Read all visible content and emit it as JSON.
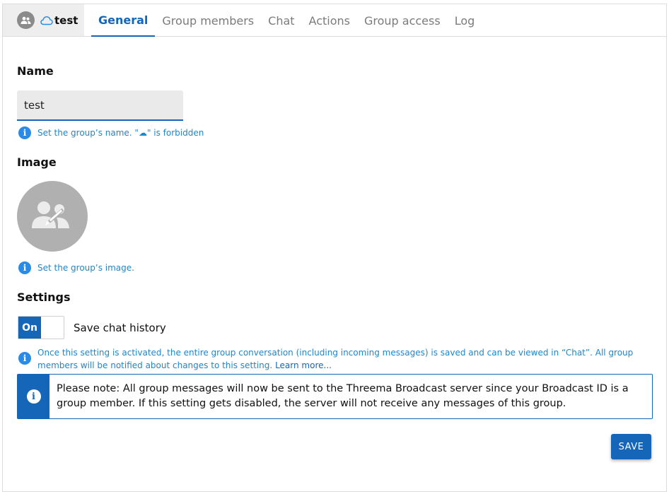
{
  "header": {
    "group_icon": "group-icon",
    "cloud_icon": "cloud-icon",
    "group_name": "test"
  },
  "tabs": [
    {
      "label": "General",
      "active": true
    },
    {
      "label": "Group members",
      "active": false
    },
    {
      "label": "Chat",
      "active": false
    },
    {
      "label": "Actions",
      "active": false
    },
    {
      "label": "Group access",
      "active": false
    },
    {
      "label": "Log",
      "active": false
    }
  ],
  "name_section": {
    "title": "Name",
    "value": "test",
    "hint": "Set the group’s name. \"☁\" is forbidden"
  },
  "image_section": {
    "title": "Image",
    "placeholder_icon": "edit-group-image-icon",
    "hint": "Set the group’s image."
  },
  "settings_section": {
    "title": "Settings",
    "toggle_state": "On",
    "toggle_label": "Save chat history",
    "hint": "Once this setting is activated, the entire group conversation (including incoming messages) is saved and can be viewed in “Chat”. All group members will be notified about changes to this setting.",
    "learn_more": "Learn more...",
    "notice": "Please note: All group messages will now be sent to the Threema Broadcast server since your Broadcast ID is a group member. If this setting gets disabled, the server will not receive any messages of this group."
  },
  "actions": {
    "save_label": "SAVE"
  },
  "colors": {
    "accent": "#1565b8",
    "hint_text": "#1f86c8",
    "tab_inactive": "#7b7b7b",
    "avatar_gray": "#b0b0b0"
  }
}
